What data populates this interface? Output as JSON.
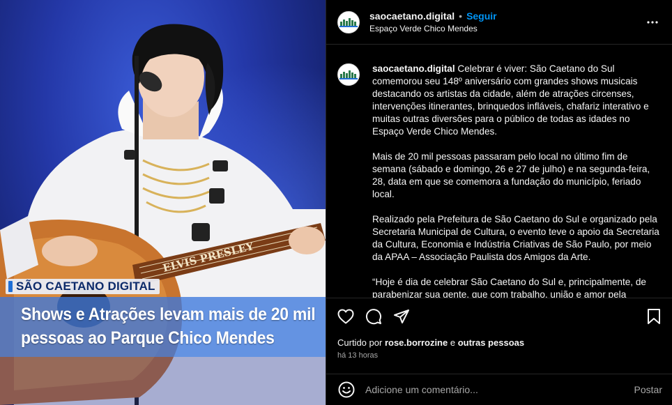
{
  "media": {
    "brand_text": "SÃO CAETANO DIGITAL",
    "headline_line1": "Shows e Atrações levam mais de 20 mil",
    "headline_line2": "pessoas ao Parque Chico Mendes",
    "guitar_text": "ELVIS PRESLEY"
  },
  "header": {
    "username": "saocaetano.digital",
    "separator": "•",
    "follow_label": "Seguir",
    "location": "Espaço Verde Chico Mendes",
    "more_icon": "more-horizontal-icon"
  },
  "caption": {
    "username": "saocaetano.digital",
    "paragraph1": "Celebrar é viver: São Caetano do Sul comemorou seu 148º aniversário com grandes shows musicais destacando os artistas da cidade, além de atrações circenses, intervenções itinerantes, brinquedos infláveis, chafariz interativo e muitas outras diversões para o público de todas as idades no Espaço Verde Chico Mendes.",
    "paragraph2": "Mais de 20 mil pessoas passaram pelo local no último fim de semana (sábado e domingo, 26 e 27 de julho) e na segunda-feira, 28, data em que se comemora a fundação do município, feriado local.",
    "paragraph3": "Realizado pela Prefeitura de São Caetano do Sul e organizado pela Secretaria Municipal de Cultura, o evento teve o apoio da Secretaria da Cultura, Economia e Indústria Criativas de São Paulo, por meio da APAA – Associação Paulista dos Amigos da Arte.",
    "paragraph4": "“Hoje é dia de celebrar São Caetano do Sul e, principalmente, de parabenizar sua gente, que com trabalho, união e amor pela"
  },
  "actions": {
    "icons": [
      "heart-icon",
      "comment-icon",
      "share-icon",
      "bookmark-icon"
    ],
    "liked_by_prefix": "Curtido por",
    "liked_by_user": "rose.borrozine",
    "liked_by_conj": "e",
    "liked_by_others": "outras pessoas",
    "time_ago": "há 13 horas"
  },
  "comment": {
    "placeholder": "Adicione um comentário...",
    "post_label": "Postar"
  },
  "colors": {
    "background": "#000000",
    "link_blue": "#0095f6",
    "muted_text": "#a8a8a8",
    "divider": "#262626",
    "headline_band": "#3c78dc"
  }
}
